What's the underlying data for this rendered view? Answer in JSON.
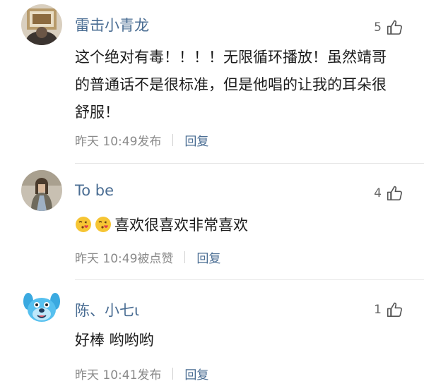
{
  "comments": [
    {
      "username": "雷击小青龙",
      "likes": "5",
      "text": "这个绝对有毒！！！！无限循环播放！虽然靖哥的普通话不是很标准，但是他唱的让我的耳朵很舒服！",
      "time_status": "昨天 10:49发布",
      "reply_label": "回复",
      "avatar_icon": "portrait-avatar-icon"
    },
    {
      "username": "To be",
      "likes": "4",
      "emoji_icons": [
        "blowing-kiss-emoji-icon",
        "blowing-kiss-emoji-icon"
      ],
      "text": "喜欢很喜欢非常喜欢",
      "time_status": "昨天 10:49被点赞",
      "reply_label": "回复",
      "avatar_icon": "person-photo-avatar-icon"
    },
    {
      "username": "陈、小七ι",
      "likes": "1",
      "text": "好棒 哟哟哟",
      "time_status": "昨天 10:41发布",
      "reply_label": "回复",
      "avatar_icon": "blue-cartoon-dog-avatar-icon"
    }
  ],
  "colors": {
    "username": "#4a6d93",
    "reply": "#4a6d93",
    "meta": "#8a8a8a",
    "text": "#1b1b1b",
    "divider": "#e6e6e6"
  }
}
